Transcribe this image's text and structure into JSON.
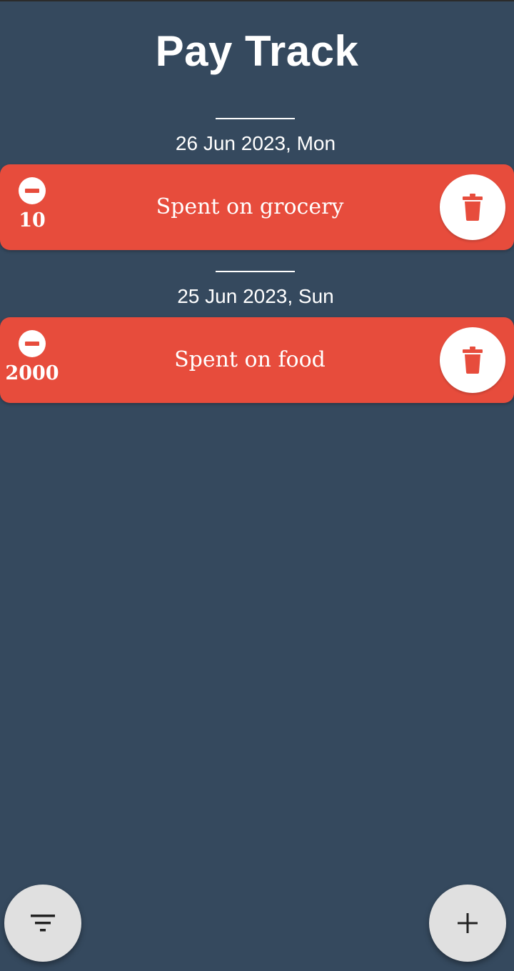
{
  "app": {
    "title": "Pay Track"
  },
  "colors": {
    "background": "#35495e",
    "expense_card": "#e74c3c",
    "fab_background": "#e0e0e0",
    "text": "#ffffff"
  },
  "groups": [
    {
      "date": "26 Jun 2023, Mon",
      "transactions": [
        {
          "type_icon": "minus-circle-icon",
          "amount": "10",
          "description": "Spent on grocery",
          "action_icon": "trash-icon"
        }
      ]
    },
    {
      "date": "25 Jun 2023, Sun",
      "transactions": [
        {
          "type_icon": "minus-circle-icon",
          "amount": "2000",
          "description": "Spent on food",
          "action_icon": "trash-icon"
        }
      ]
    }
  ],
  "fabs": {
    "filter_icon": "filter-icon",
    "add_icon": "plus-icon"
  }
}
